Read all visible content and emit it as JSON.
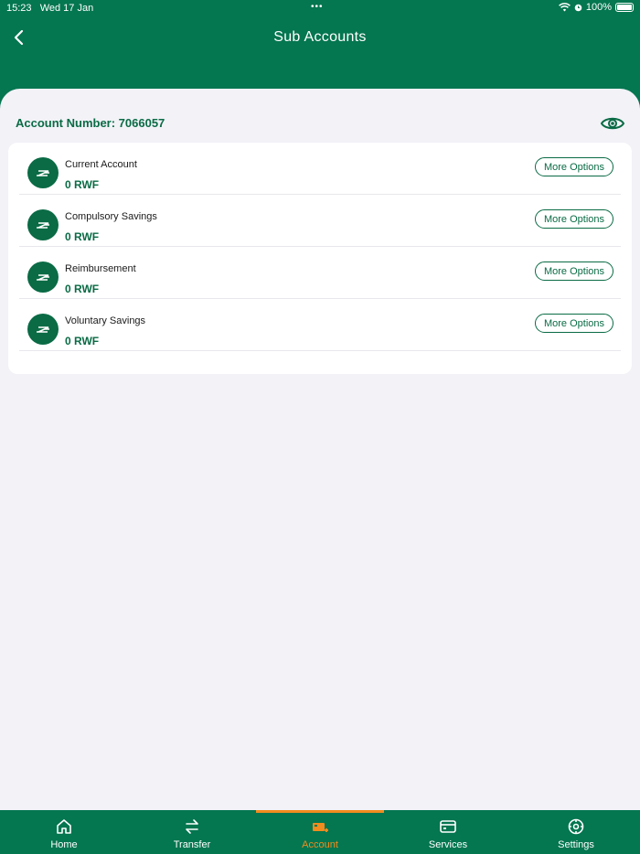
{
  "status": {
    "time": "15:23",
    "date": "Wed 17 Jan",
    "battery": "100%"
  },
  "header": {
    "title": "Sub Accounts"
  },
  "account": {
    "number_label": "Account Number: 7066057"
  },
  "sub_accounts": [
    {
      "name": "Current Account",
      "balance": "0 RWF",
      "action": "More Options"
    },
    {
      "name": "Compulsory Savings",
      "balance": "0 RWF",
      "action": "More Options"
    },
    {
      "name": "Reimbursement",
      "balance": "0 RWF",
      "action": "More Options"
    },
    {
      "name": "Voluntary Savings",
      "balance": "0 RWF",
      "action": "More Options"
    }
  ],
  "tabs": [
    {
      "label": "Home",
      "icon": "home-icon"
    },
    {
      "label": "Transfer",
      "icon": "transfer-icon"
    },
    {
      "label": "Account",
      "icon": "account-icon",
      "active": true
    },
    {
      "label": "Services",
      "icon": "card-icon"
    },
    {
      "label": "Settings",
      "icon": "gear-icon"
    }
  ],
  "colors": {
    "brand_green": "#047650",
    "accent_orange": "#f28c1e",
    "background": "#f2f2f7"
  }
}
